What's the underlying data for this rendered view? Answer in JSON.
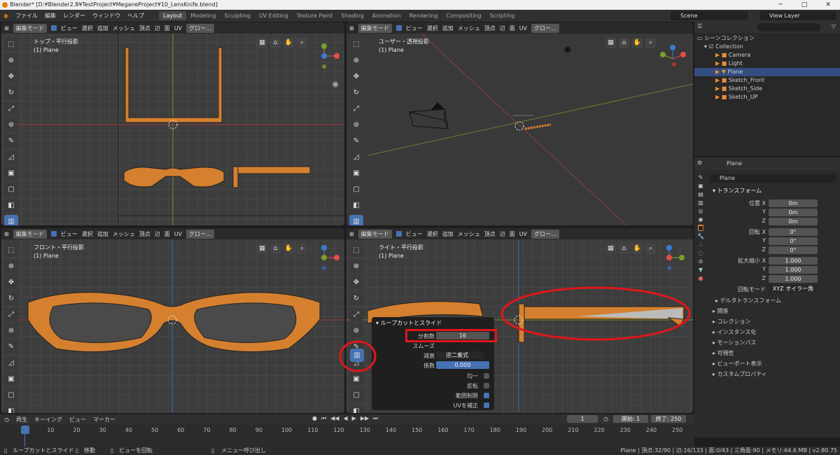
{
  "window": {
    "title": "Blender* [D:¥Blender2.8¥TestProject¥MeganeProject¥10_LensKnife.blend]",
    "controls": [
      "─",
      "□",
      "✕"
    ]
  },
  "menu": {
    "items": [
      "ファイル",
      "編集",
      "レンダー",
      "ウィンドウ",
      "ヘルプ"
    ]
  },
  "workspaces": [
    "Layout",
    "Modeling",
    "Sculpting",
    "UV Editing",
    "Texture Paint",
    "Shading",
    "Animation",
    "Rendering",
    "Compositing",
    "Scripting"
  ],
  "scene": {
    "label": "Scene",
    "view_layer": "View Layer"
  },
  "viewport_header": {
    "mode": "編集モード",
    "menus": [
      "ビュー",
      "選択",
      "追加",
      "メッシュ",
      "頂点",
      "辺",
      "面",
      "UV"
    ],
    "transform": "グロー..."
  },
  "viewports": {
    "top": {
      "title": "トップ・平行投影",
      "object": "(1) Plane"
    },
    "user": {
      "title": "ユーザー・透視投影",
      "object": "(1) Plane"
    },
    "front": {
      "title": "フロント・平行投影",
      "object": "(1) Plane"
    },
    "right": {
      "title": "ライト・平行投影",
      "object": "(1) Plane"
    }
  },
  "outliner": {
    "search_placeholder": "",
    "root": "シーンコレクション",
    "collection": "Collection",
    "items": [
      "Camera",
      "Light",
      "Plane",
      "Sketch_Front",
      "Sketch_Side",
      "Sketch_UP"
    ]
  },
  "properties": {
    "object_name": "Plane",
    "data_name": "Plane",
    "transform_header": "トランスフォーム",
    "location_label": "位置 X",
    "rotation_label": "回転 X",
    "scale_label": "拡大縮小 X",
    "axis_y": "Y",
    "axis_z": "Z",
    "loc": [
      "0m",
      "0m",
      "0m"
    ],
    "rot": [
      "0°",
      "0°",
      "0°"
    ],
    "scale": [
      "1.000",
      "1.000",
      "1.000"
    ],
    "rot_mode_label": "回転モード",
    "rot_mode": "XYZ オイラー角",
    "sections": [
      "デルタトランスフォーム",
      "関係",
      "コレクション",
      "インスタンス化",
      "モーションパス",
      "可視性",
      "ビューポート表示",
      "カスタムプロパティ"
    ]
  },
  "redo_panel": {
    "title": "ループカットとスライド",
    "cuts_label": "分割数",
    "cuts_value": "16",
    "smooth_label": "スムーズ",
    "falloff_label": "減衰",
    "falloff_value": "逆二乗式",
    "factor_label": "係数",
    "factor_value": "0.000",
    "even_label": "均一",
    "flip_label": "反転",
    "clamp_label": "範囲制限",
    "uv_label": "UVを補正"
  },
  "timeline": {
    "menus": [
      "再生",
      "キーイング",
      "ビュー",
      "マーカー"
    ],
    "current_frame": "1",
    "start_label": "開始:",
    "start": "1",
    "end_label": "終了:",
    "end": "250",
    "ticks": [
      "1",
      "10",
      "20",
      "30",
      "40",
      "50",
      "60",
      "70",
      "80",
      "90",
      "100",
      "110",
      "120",
      "130",
      "140",
      "150",
      "160",
      "170",
      "180",
      "190",
      "200",
      "210",
      "220",
      "230",
      "240",
      "250"
    ]
  },
  "status": {
    "left": "ループカットとスライド",
    "move": "移動",
    "rotate_view": "ビューを回転",
    "menu": "メニュー呼び出し",
    "right": "Plane | 頂点:32/90 | 辺:16/133 | 面:0/43 | 三角面:90 | メモリ:64.6 MB | v2.80.75"
  },
  "colors": {
    "accent": "#4772b3",
    "mesh": "#d4802f",
    "highlight": "#e0161b",
    "panel": "#2b2b2b"
  }
}
